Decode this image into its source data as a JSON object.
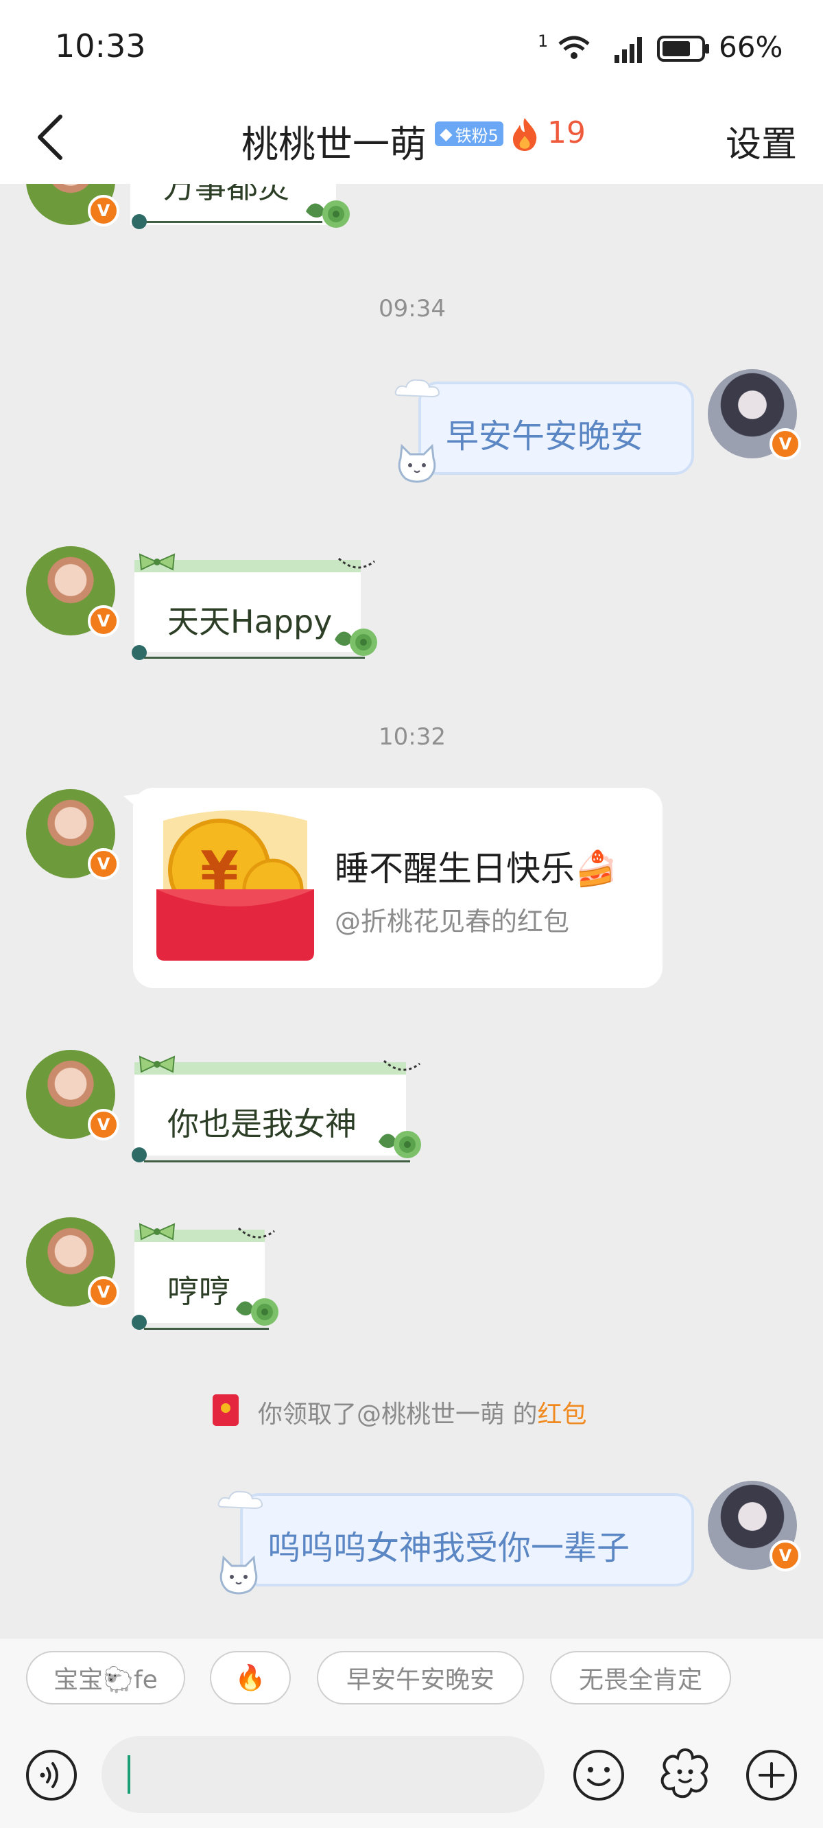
{
  "status_bar": {
    "time": "10:33",
    "sim_label": "1",
    "battery_percent": "66%",
    "icons": [
      "wifi-icon",
      "signal-icon",
      "battery-icon"
    ]
  },
  "header": {
    "title": "桃桃世一萌",
    "fan_badge": "铁粉5",
    "streak_count": "19",
    "settings_label": "设置",
    "icons": [
      "back-arrow-icon",
      "fire-icon"
    ]
  },
  "messages": {
    "partial_top": "万事都灵",
    "timestamp_1": "09:34",
    "out_1": "早安午安晚安",
    "in_1": "天天Happy",
    "timestamp_2": "10:32",
    "red_packet": {
      "title": "睡不醒生日快乐🍰",
      "subtitle": "@折桃花见春的红包"
    },
    "in_2": "你也是我女神",
    "in_3": "哼哼",
    "notice_prefix": "你领取了@桃桃世一萌 的",
    "notice_link": "红包",
    "out_2": "呜呜呜女神我受你一辈子"
  },
  "quick_replies": [
    "宝宝🐑fe",
    "🔥",
    "早安午安晚安",
    "无畏全肯定"
  ],
  "input": {
    "value": "",
    "icons": [
      "voice-icon",
      "emoji-icon",
      "sticker-icon",
      "plus-icon"
    ]
  },
  "colors": {
    "accent_green": "#1a9e74",
    "streak_red": "#f05a3c",
    "link_orange": "#f08a1f",
    "badge_blue": "#6aa8f5"
  }
}
